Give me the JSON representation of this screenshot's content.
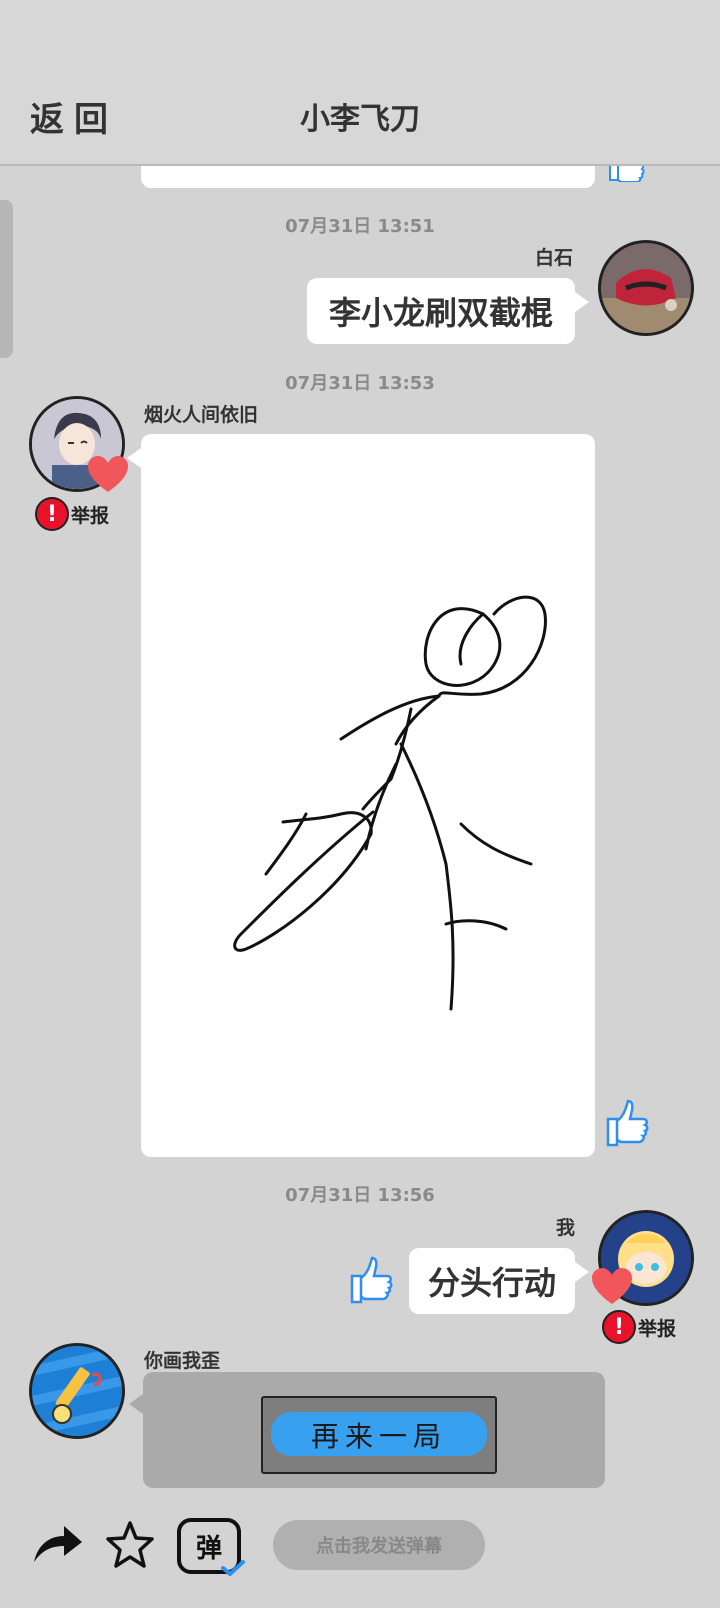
{
  "header": {
    "back_label": "返回",
    "title": "小李飞刀"
  },
  "messages": [
    {
      "timestamp": "07月31日  13:51",
      "sender": "白石",
      "text": "李小龙刷双截棍"
    },
    {
      "timestamp": "07月31日  13:53",
      "sender": "烟火人间依旧",
      "report_label": "举报"
    },
    {
      "timestamp": "07月31日  13:56",
      "sender": "我",
      "text": "分头行动",
      "report_label": "举报"
    },
    {
      "sender": "你画我歪",
      "play_again_label": "再来一局"
    }
  ],
  "footer": {
    "danmu_placeholder": "点击我发送弹幕",
    "danmu_icon_char": "弹"
  },
  "icons": [
    "share-icon",
    "star-icon",
    "danmu-icon",
    "thumbs-up-icon",
    "heart-icon",
    "warning-icon"
  ],
  "colors": {
    "accent_blue": "#2f8ff0",
    "heart_red": "#f0565a",
    "warning_red": "#e8122a",
    "background": "#d3d3d3"
  }
}
